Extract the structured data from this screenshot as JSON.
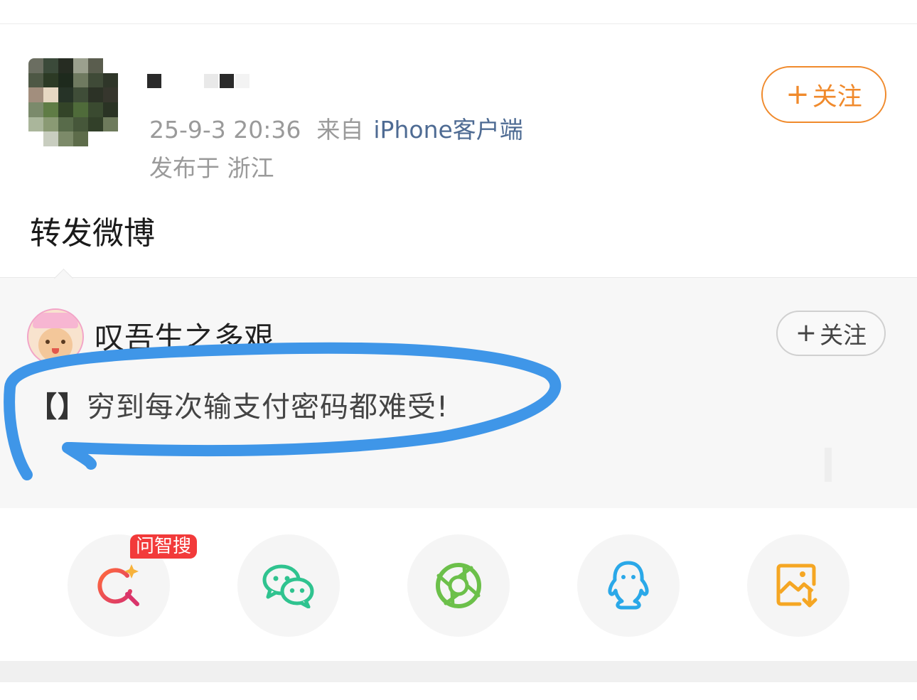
{
  "post": {
    "timestamp": "25-9-3 20:36",
    "from_label": "来自",
    "source": "iPhone客户端",
    "location_label": "发布于 浙江",
    "follow_label": "关注",
    "text": "转发微博"
  },
  "retweet": {
    "author": "叹吾生之多艰",
    "follow_label": "关注",
    "bracket": "【】",
    "text": "穷到每次输支付密码都难受!"
  },
  "share": {
    "ai_search_badge": "问智搜",
    "targets": [
      {
        "icon": "ai-search-icon",
        "color": "#e84a5f"
      },
      {
        "icon": "wechat-icon",
        "color": "#2fc38f"
      },
      {
        "icon": "moments-icon",
        "color": "#6cc04a"
      },
      {
        "icon": "qq-icon",
        "color": "#2aa8e8"
      },
      {
        "icon": "save-image-icon",
        "color": "#f5a623"
      }
    ]
  },
  "colors": {
    "accent_orange": "#f08a2c",
    "source_link": "#4e6b93",
    "annotation_blue": "#3f96e8"
  }
}
